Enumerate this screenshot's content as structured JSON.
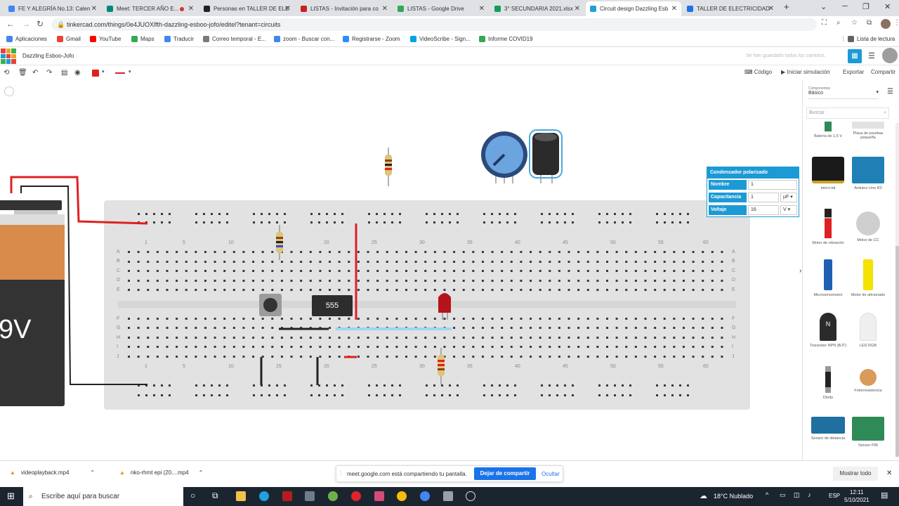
{
  "browser": {
    "tabs": [
      {
        "label": "FE Y ALEGRÍA No.13: Calen",
        "color": "#4285f4"
      },
      {
        "label": "Meet: TERCER AÑO E...",
        "color": "#00897b"
      },
      {
        "label": "Personas en TALLER DE ELE",
        "color": "#202124"
      },
      {
        "label": "LISTAS - Invitación para co",
        "color": "#c5221f"
      },
      {
        "label": "LISTAS - Google Drive",
        "color": "#34a853"
      },
      {
        "label": "3° SECUNDARIA 2021.xlsx",
        "color": "#0f9d58"
      },
      {
        "label": "Circuit design Dazzling Esb",
        "color": "#21a0d8"
      },
      {
        "label": "TALLER DE ELECTRICIDAD",
        "color": "#1a73e8"
      }
    ],
    "url": "tinkercad.com/things/0e4JUOXlfth-dazzling-esboo-jofo/editel?tenant=circuits",
    "bookmarks": [
      {
        "label": "Aplicaciones",
        "color": "#4285f4"
      },
      {
        "label": "Gmail",
        "color": "#ea4335"
      },
      {
        "label": "YouTube",
        "color": "#ff0000"
      },
      {
        "label": "Maps",
        "color": "#34a853"
      },
      {
        "label": "Traducir",
        "color": "#4285f4"
      },
      {
        "label": "Correo temporal - E...",
        "color": "#7a7a7a"
      },
      {
        "label": "zoom - Buscar con...",
        "color": "#4285f4"
      },
      {
        "label": "Registrarse - Zoom",
        "color": "#2d8cff"
      },
      {
        "label": "VideoScribe - Sign...",
        "color": "#00a4e4"
      },
      {
        "label": "Informe COVID19",
        "color": "#34a853"
      }
    ],
    "reading_list": "Lista de lectura"
  },
  "app": {
    "title": "Dazzling Esboo-Jofo",
    "saved_status": "Se han guardado todos los cambios.",
    "toolbar": {
      "code": "Código",
      "simulate": "Iniciar simulación",
      "export": "Exportar",
      "share": "Compartir"
    }
  },
  "inspector": {
    "title": "Condensador polarizado",
    "name_label": "Nombre",
    "name_value": "1",
    "cap_label": "Capacitancia",
    "cap_value": "1",
    "cap_unit": "µF",
    "volt_label": "Voltaje",
    "volt_value": "16",
    "volt_unit": "V"
  },
  "canvas": {
    "battery_label": "9V",
    "chip_label": "555",
    "col_numbers": [
      "1",
      "5",
      "10",
      "15",
      "20",
      "25",
      "30",
      "35",
      "40",
      "45",
      "50",
      "55",
      "60"
    ],
    "row_letters_top": [
      "A",
      "B",
      "C",
      "D",
      "E"
    ],
    "row_letters_bottom": [
      "F",
      "G",
      "H",
      "I",
      "J"
    ]
  },
  "sidebar": {
    "components_label": "Componentes",
    "category": "Básico",
    "search_placeholder": "Buscar",
    "components": [
      {
        "label": "Batería de 1,5 V",
        "icon": "battery-icon"
      },
      {
        "label": "Placa de pruebas pequeña",
        "icon": "breadboard-icon"
      },
      {
        "label": "micro:bit",
        "icon": "microbit-icon"
      },
      {
        "label": "Arduino Uno R3",
        "icon": "arduino-icon"
      },
      {
        "label": "Motor de vibración",
        "icon": "vibration-motor-icon"
      },
      {
        "label": "Motor de CC",
        "icon": "dc-motor-icon"
      },
      {
        "label": "Microservomotor",
        "icon": "servo-icon"
      },
      {
        "label": "Motor de aficionado",
        "icon": "hobby-motor-icon"
      },
      {
        "label": "Transistor NPN (BJT)",
        "icon": "transistor-icon"
      },
      {
        "label": "LED RGB",
        "icon": "rgb-led-icon"
      },
      {
        "label": "Diodo",
        "icon": "diode-icon"
      },
      {
        "label": "Fotorresistencia",
        "icon": "photoresistor-icon"
      },
      {
        "label": "Sensor de distancia",
        "icon": "ultrasonic-sensor-icon"
      },
      {
        "label": "Sensor PIR",
        "icon": "pir-sensor-icon"
      }
    ]
  },
  "downloads": {
    "items": [
      "videoplayback.mp4",
      "nko-rhmt epi (20....mp4"
    ],
    "show_all": "Mostrar todo"
  },
  "share_bar": {
    "message": "meet.google.com está compartiendo tu pantalla.",
    "stop": "Dejar de compartir",
    "hide": "Ocultar"
  },
  "taskbar": {
    "search": "Escribe aquí para buscar",
    "weather": "18°C  Nublado",
    "lang": "ESP",
    "time": "12:11",
    "date": "5/10/2021"
  }
}
